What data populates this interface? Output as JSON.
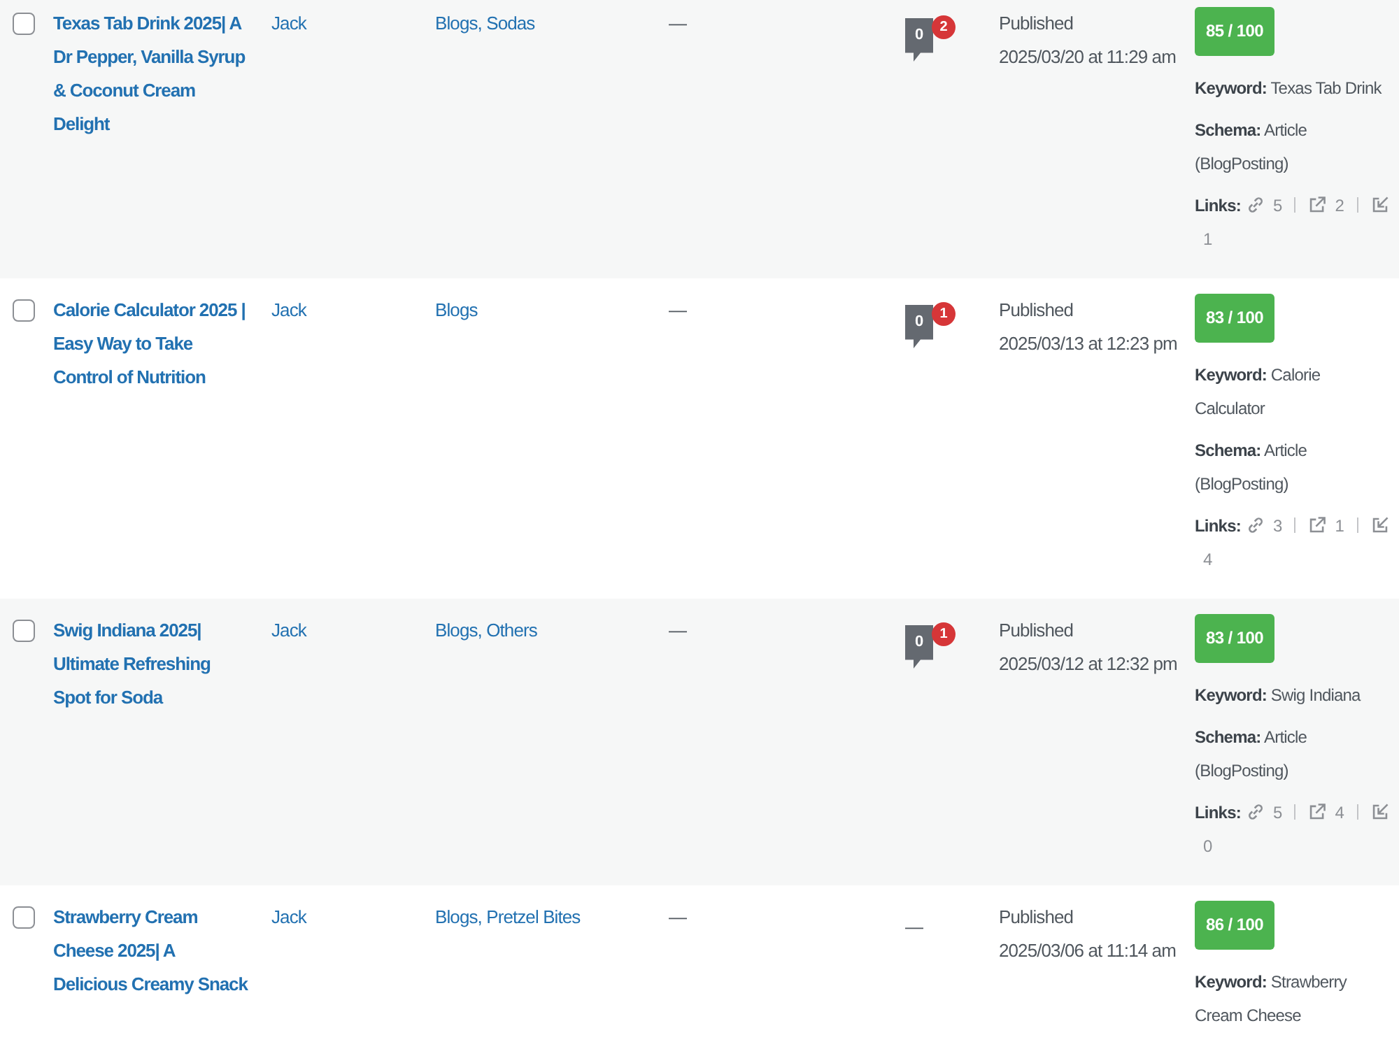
{
  "posts": [
    {
      "checked": false,
      "title": "Texas Tab Drink 2025| A Dr Pepper, Vanilla Syrup & Coconut Cream Delight",
      "author": "Jack",
      "categories": "Blogs, Sodas",
      "tags": "—",
      "comments": {
        "kind": "bubbles",
        "approved": "0",
        "pending": "2"
      },
      "status": "Published",
      "date": "2025/03/20 at 11:29 am",
      "seo": {
        "score": "85 / 100",
        "keyword": "**Keyword:** Texas Tab Drink",
        "schema": "**Schema:** Article (BlogPosting)",
        "links": {
          "label": "Links:",
          "counts": [
            {
              "kind": "internal",
              "value": "5"
            },
            {
              "kind": "external",
              "value": "2"
            },
            {
              "kind": "incoming",
              "value": "1"
            }
          ]
        }
      }
    },
    {
      "checked": false,
      "title": "Calorie Calculator 2025 | Easy Way to Take Control of Nutrition",
      "author": "Jack",
      "categories": "Blogs",
      "tags": "—",
      "comments": {
        "kind": "bubbles",
        "approved": "0",
        "pending": "1"
      },
      "status": "Published",
      "date": "2025/03/13 at 12:23 pm",
      "seo": {
        "score": "83 / 100",
        "keyword": "**Keyword:** Calorie Calculator",
        "schema": "**Schema:** Article (BlogPosting)",
        "links": {
          "label": "Links:",
          "counts": [
            {
              "kind": "internal",
              "value": "3"
            },
            {
              "kind": "external",
              "value": "1"
            },
            {
              "kind": "incoming",
              "value": "4"
            }
          ]
        }
      }
    },
    {
      "checked": false,
      "title": "Swig Indiana 2025| Ultimate Refreshing Spot for Soda",
      "author": "Jack",
      "categories": "Blogs, Others",
      "tags": "—",
      "comments": {
        "kind": "bubbles",
        "approved": "0",
        "pending": "1"
      },
      "status": "Published",
      "date": "2025/03/12 at 12:32 pm",
      "seo": {
        "score": "83 / 100",
        "keyword": "**Keyword:** Swig Indiana",
        "schema": "**Schema:** Article (BlogPosting)",
        "links": {
          "label": "Links:",
          "counts": [
            {
              "kind": "internal",
              "value": "5"
            },
            {
              "kind": "external",
              "value": "4"
            },
            {
              "kind": "incoming",
              "value": "0"
            }
          ]
        }
      }
    },
    {
      "checked": false,
      "title": "Strawberry Cream Cheese 2025| A Delicious Creamy Snack",
      "author": "Jack",
      "categories": "Blogs, Pretzel Bites",
      "tags": "—",
      "comments": {
        "kind": "none",
        "text": "—"
      },
      "status": "Published",
      "date": "2025/03/06 at 11:14 am",
      "seo": {
        "score": "86 / 100",
        "keyword": "**Keyword:** Strawberry Cream Cheese"
      }
    }
  ]
}
